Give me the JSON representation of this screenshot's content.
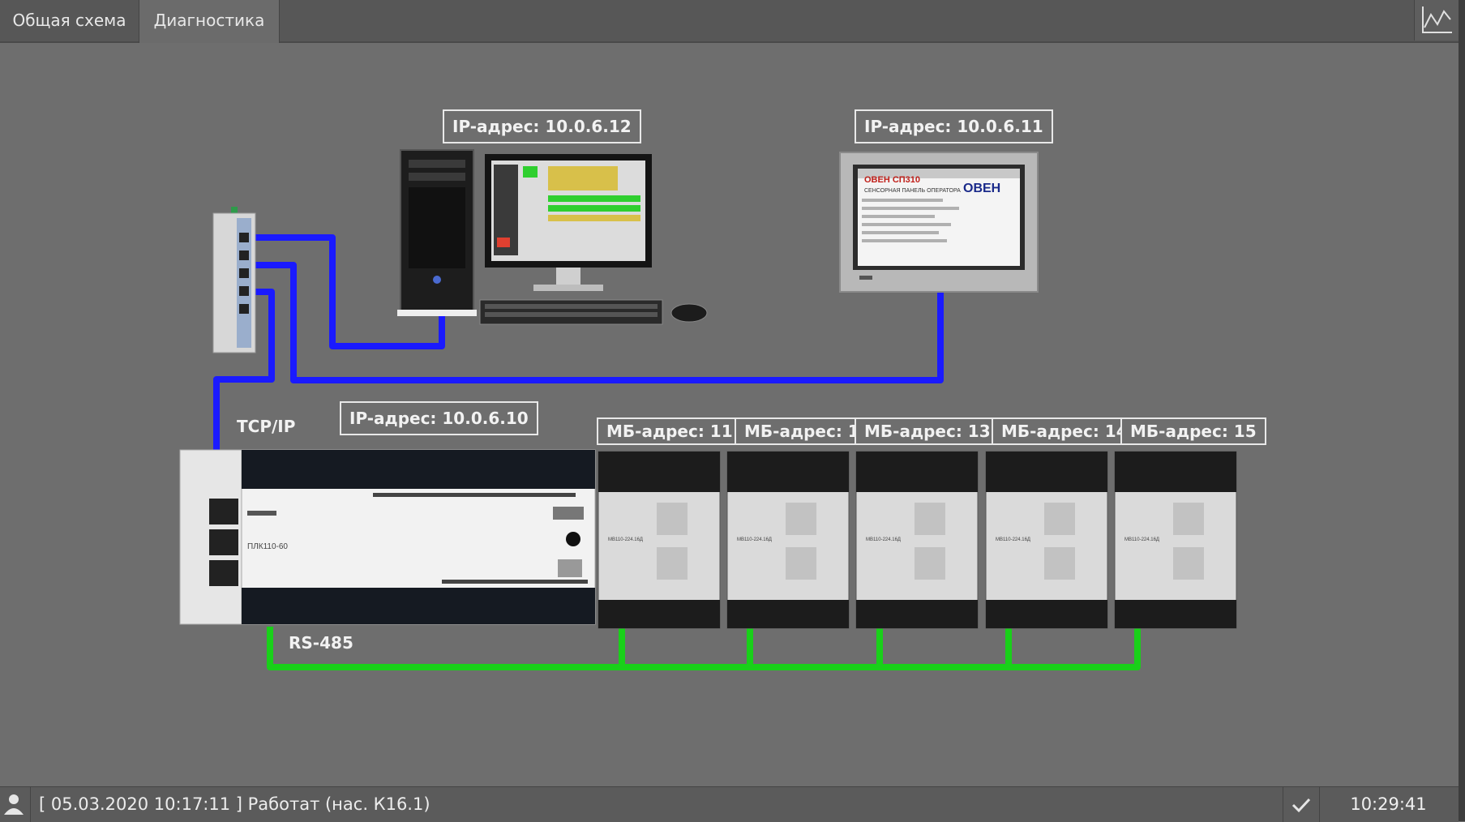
{
  "tabs": [
    {
      "label": "Общая схема"
    },
    {
      "label": "Диагностика"
    }
  ],
  "toolbar": {
    "trend_icon": "chart-line-icon"
  },
  "network": {
    "pc_ip": "IP-адрес: 10.0.6.12",
    "panel_ip": "IP-адрес: 10.0.6.11",
    "plc_ip": "IP-адрес: 10.0.6.10",
    "tcp_label": "TCP/IP",
    "rs485_label": "RS-485",
    "panel_brand": "ОВЕН СП310",
    "panel_sub": "СЕНСОРНАЯ ПАНЕЛЬ ОПЕРАТОРА",
    "panel_logo": "ОВЕН",
    "plc_model": "ПЛК110-60",
    "modules": [
      {
        "label": "МБ-адрес: 11"
      },
      {
        "label": "МБ-адрес: 12"
      },
      {
        "label": "МБ-адрес: 13"
      },
      {
        "label": "МБ-адрес: 14"
      },
      {
        "label": "МБ-адрес: 15"
      }
    ],
    "module_model": "МВ110-224.16Д"
  },
  "colors": {
    "ethernet": "#1a1aff",
    "rs485": "#19d019",
    "background": "#6e6e6e"
  },
  "status": {
    "user_icon": "user-icon",
    "message": "[ 05.03.2020  10:17:11 ]  Работат (нас. К16.1)",
    "ok_icon": "check-icon",
    "time": "10:29:41"
  }
}
